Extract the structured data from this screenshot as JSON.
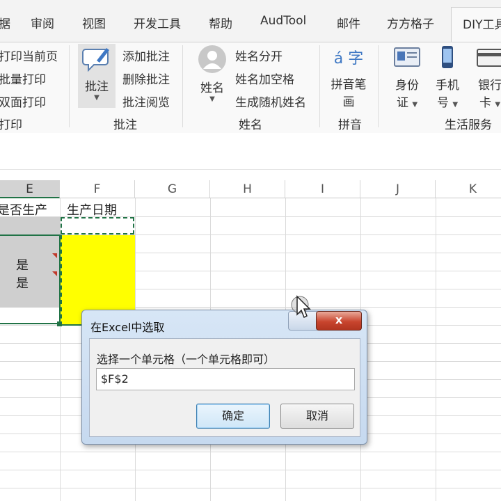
{
  "tabs": [
    "据",
    "审阅",
    "视图",
    "开发工具",
    "帮助",
    "AudTool",
    "邮件",
    "方方格子",
    "DIY工具"
  ],
  "print_group": {
    "items": [
      "打印当前页",
      "批量打印",
      "双面打印",
      "打印"
    ]
  },
  "comment_group": {
    "big_button": "批注",
    "items": [
      "添加批注",
      "删除批注",
      "批注阅览"
    ],
    "label": "批注"
  },
  "name_group": {
    "big_button": "姓名",
    "items": [
      "姓名分开",
      "姓名加空格",
      "生成随机姓名"
    ],
    "label": "姓名"
  },
  "pinyin_group": {
    "big_button_line1": "拼音笔",
    "big_button_line2": "画",
    "label": "拼音",
    "icon_text": "á 字"
  },
  "life_group": {
    "id_line1": "身份",
    "id_line2": "证",
    "phone_line1": "手机",
    "phone_line2": "号",
    "bank_line1": "银行",
    "bank_line2": "卡",
    "label": "生活服务"
  },
  "columns": [
    "E",
    "F",
    "G",
    "H",
    "I",
    "J",
    "K"
  ],
  "cells": {
    "e1": "是否生产",
    "f1": "生产日期",
    "e_vals": [
      "是",
      "是"
    ]
  },
  "colors": {
    "highlight": "#ffff00",
    "excel_green": "#217346",
    "selected_gray": "#cfcfcf"
  },
  "dialog": {
    "title": "在Excel中选取",
    "close_label": "x",
    "prompt": "选择一个单元格（一个单元格即可）",
    "value": "$F$2",
    "ok": "确定",
    "cancel": "取消"
  }
}
